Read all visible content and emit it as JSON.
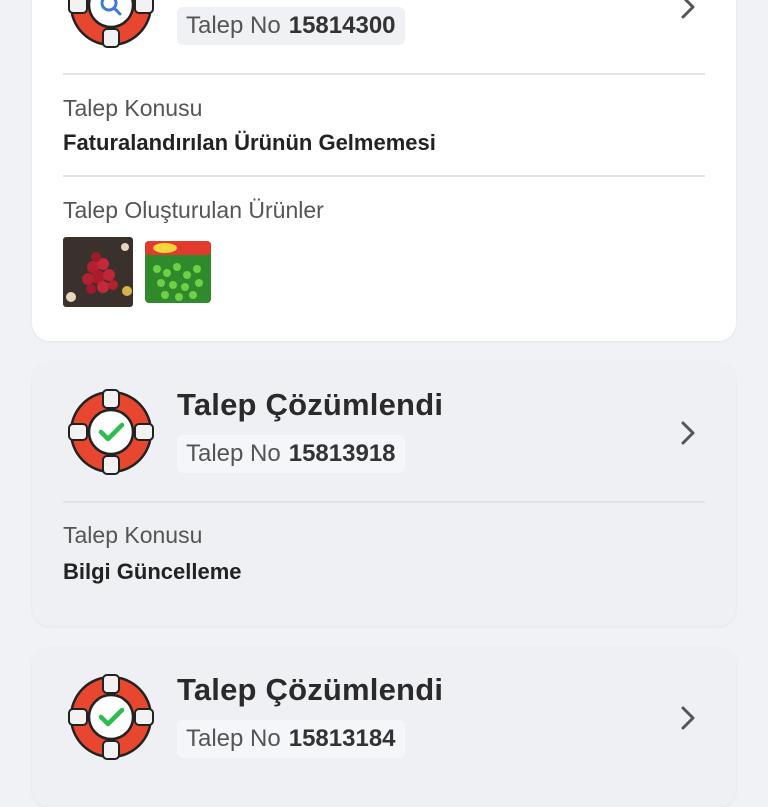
{
  "requests": [
    {
      "status_icon": "lifebuoy-search-icon",
      "ticket_label": "Talep No",
      "ticket_number": "15814300",
      "subject_label": "Talep Konusu",
      "subject_value": "Faturalandırılan Ürünün Gelmemesi",
      "products_label": "Talep Oluşturulan Ürünler",
      "products": [
        {
          "name": "red-berries-product-image"
        },
        {
          "name": "green-peas-package-image"
        }
      ]
    },
    {
      "status_icon": "lifebuoy-check-icon",
      "status_title": "Talep Çözümlendi",
      "ticket_label": "Talep No",
      "ticket_number": "15813918",
      "subject_label": "Talep Konusu",
      "subject_value": "Bilgi Güncelleme"
    },
    {
      "status_icon": "lifebuoy-check-icon",
      "status_title": "Talep Çözümlendi",
      "ticket_label": "Talep No",
      "ticket_number": "15813184"
    }
  ],
  "colors": {
    "buoy_red": "#e8472f",
    "check_green": "#2dbd4e",
    "card_white": "#ffffff",
    "card_grey": "#eff0f4",
    "background": "#f1f2f6"
  }
}
